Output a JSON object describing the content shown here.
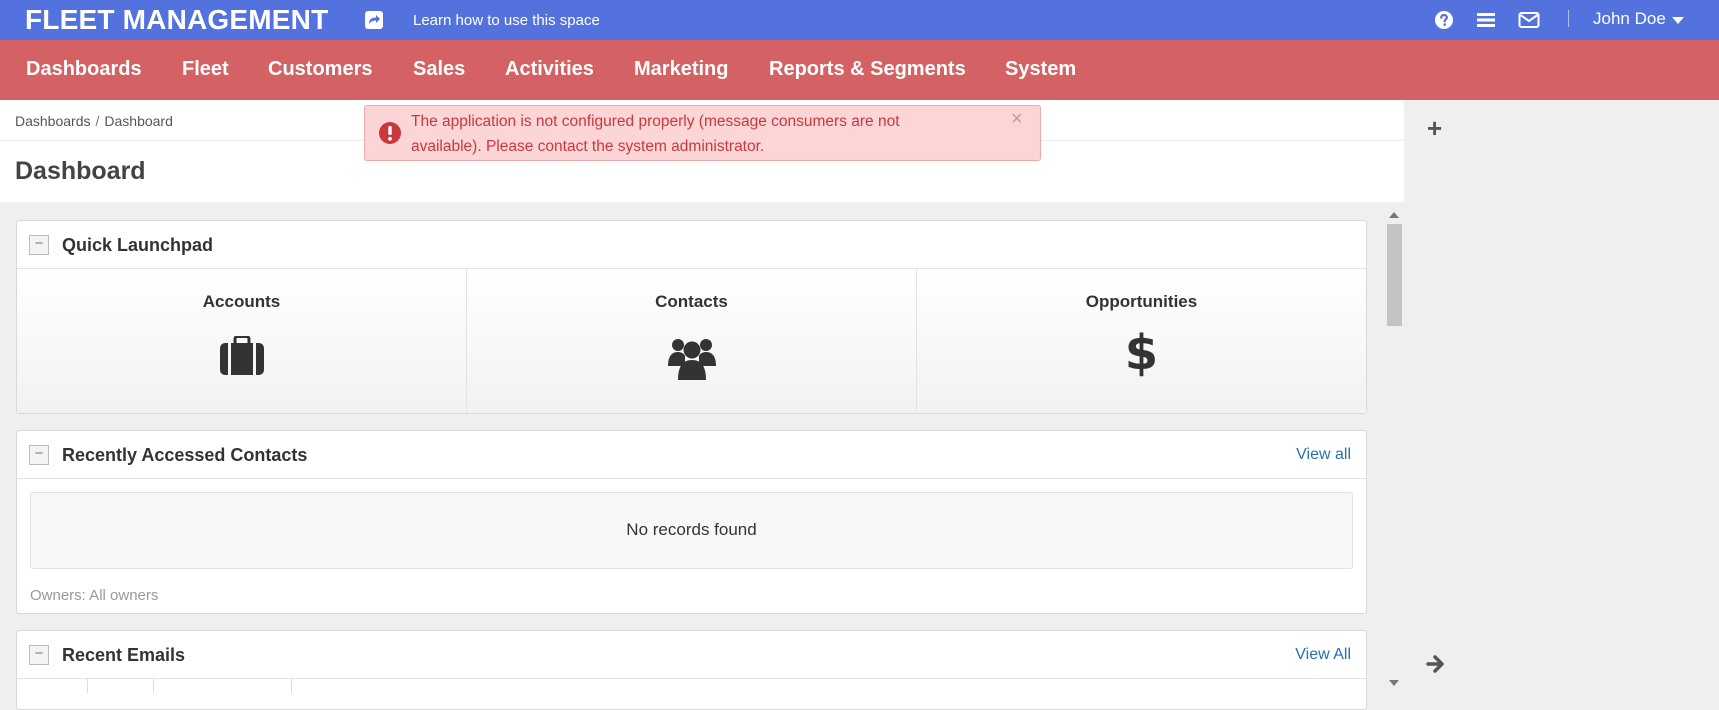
{
  "app": {
    "title": "FLEET MANAGEMENT",
    "learn_link": "Learn how to use this space"
  },
  "user": {
    "name": "John Doe"
  },
  "topbar_icons": [
    "question-circle-icon",
    "list-icon",
    "envelope-icon"
  ],
  "menu": {
    "items": [
      {
        "label": "Dashboards"
      },
      {
        "label": "Fleet"
      },
      {
        "label": "Customers"
      },
      {
        "label": "Sales"
      },
      {
        "label": "Activities"
      },
      {
        "label": "Marketing"
      },
      {
        "label": "Reports & Segments"
      },
      {
        "label": "System"
      }
    ]
  },
  "breadcrumb": {
    "parent": "Dashboards",
    "separator": "/",
    "current": "Dashboard"
  },
  "page_title": "Dashboard",
  "alert": {
    "message": "The application is not configured properly (message consumers are not available). Please contact the system administrator.",
    "close": "×"
  },
  "widgets": {
    "launchpad": {
      "title": "Quick Launchpad",
      "collapse": "−",
      "items": [
        {
          "label": "Accounts",
          "icon": "briefcase-icon"
        },
        {
          "label": "Contacts",
          "icon": "users-icon"
        },
        {
          "label": "Opportunities",
          "icon": "dollar-icon"
        }
      ]
    },
    "contacts": {
      "title": "Recently Accessed Contacts",
      "collapse": "−",
      "view_all": "View all",
      "empty": "No records found",
      "owners": "Owners: All owners"
    },
    "emails": {
      "title": "Recent Emails",
      "collapse": "−",
      "view_all": "View All"
    }
  },
  "right_panel": {
    "add": "+"
  },
  "colors": {
    "topbar": "#5372de",
    "menubar": "#d46163",
    "alert_bg": "#fcd6d7",
    "alert_text": "#c9383c",
    "link": "#2a6fb0"
  }
}
